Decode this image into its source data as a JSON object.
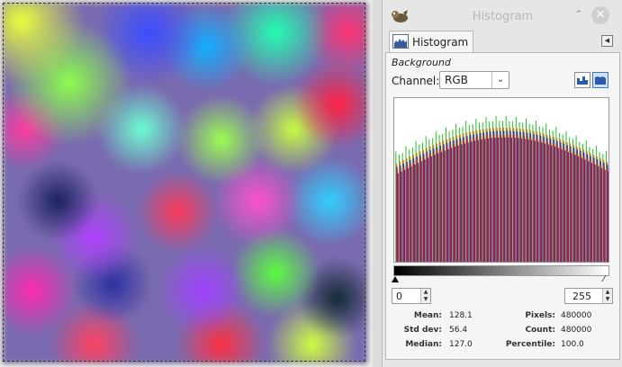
{
  "window": {
    "title": "Histogram"
  },
  "tab": {
    "label": "Histogram"
  },
  "layer_name": "Background",
  "channel": {
    "label": "Channel:",
    "value": "RGB"
  },
  "range": {
    "min": "0",
    "max": "255"
  },
  "stats": {
    "mean_label": "Mean:",
    "mean": "128.1",
    "stddev_label": "Std dev:",
    "stddev": "56.4",
    "median_label": "Median:",
    "median": "127.0",
    "pixels_label": "Pixels:",
    "pixels": "480000",
    "count_label": "Count:",
    "count": "480000",
    "percentile_label": "Percentile:",
    "percentile": "100.0"
  },
  "histogram": {
    "colors": {
      "red": "#e02020",
      "green": "#22c022",
      "blue": "#2030d0",
      "mix": "#8a1a7a",
      "orange": "#d87818"
    },
    "bar_count": 64
  },
  "icons": {
    "app": "gimp-icon",
    "minimize": "chevron-up-icon",
    "close": "close-icon",
    "tab": "histogram-icon",
    "dock_menu": "triangle-left-icon",
    "linear": "linear-histogram-icon",
    "log": "log-histogram-icon"
  }
}
